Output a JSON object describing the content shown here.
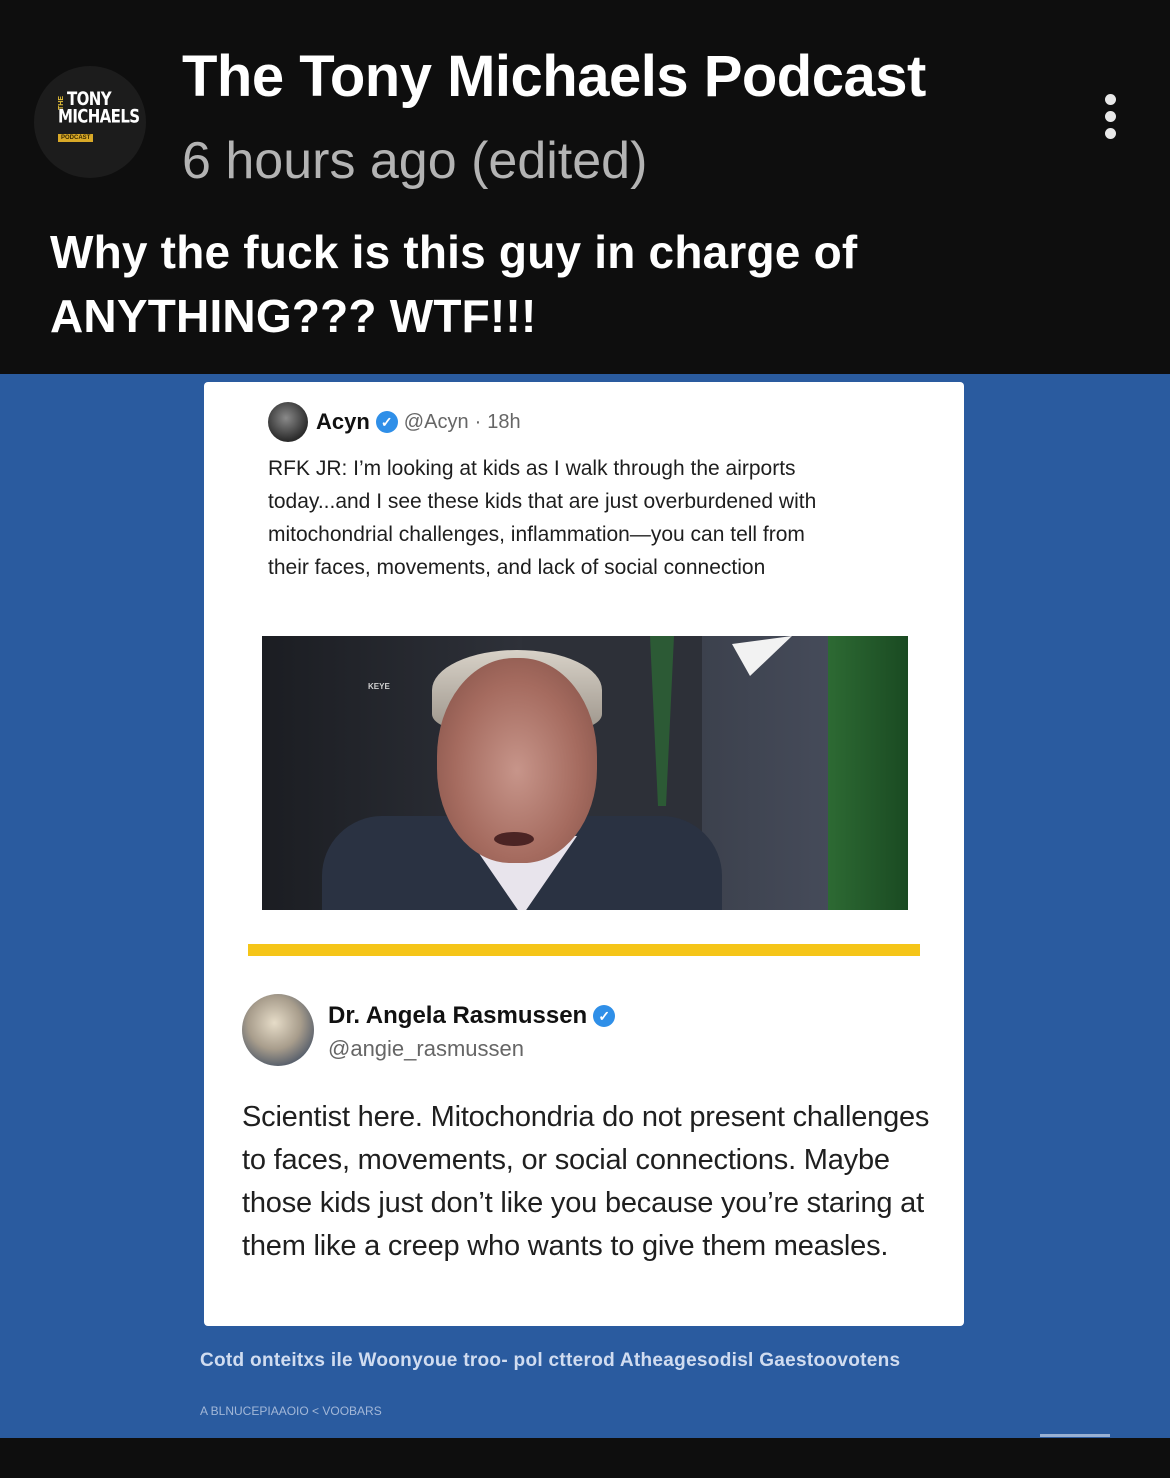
{
  "header": {
    "avatar_logo": {
      "line1": "TONY",
      "line2": "MICHAELS",
      "small_top": "THE",
      "small_bottom": "PODCAST"
    },
    "channel_name": "The Tony Michaels Podcast",
    "timestamp": "6 hours ago (edited)",
    "more_icon": "vertical-ellipsis-icon"
  },
  "post": {
    "text": "Why the fuck is this guy in charge of ANYTHING??? WTF!!!"
  },
  "media": {
    "background_color": "#2a5b9f",
    "tweet1": {
      "name": "Acyn",
      "handle": "@Acyn",
      "separator": "·",
      "time": "18h",
      "text": "RFK JR: I’m looking at kids as I walk through the airports today...and I see these kids that are just overburdened with mitochondrial challenges, inflammation—you can tell from their faces, movements, and lack of social connection",
      "photo_tag": "KEYE"
    },
    "divider_color": "#f5c518",
    "tweet2": {
      "name": "Dr. Angela Rasmussen",
      "handle": "@angie_rasmussen",
      "text": "Scientist here. Mitochondria do not present challenges to faces, movements, or social connections. Maybe those kids just don’t like you because you’re staring at them like a creep who wants to give them measles."
    },
    "caption": "Cotd onteitxs ile Woonyoue troo- pol ctterod Atheagesodisl Gaestoovotens",
    "caption_sub": "A BLNUCEPIAAOIO < VOOBARS"
  },
  "colors": {
    "verified": "#2f8fe8",
    "header_bg": "#0e0e0e"
  }
}
